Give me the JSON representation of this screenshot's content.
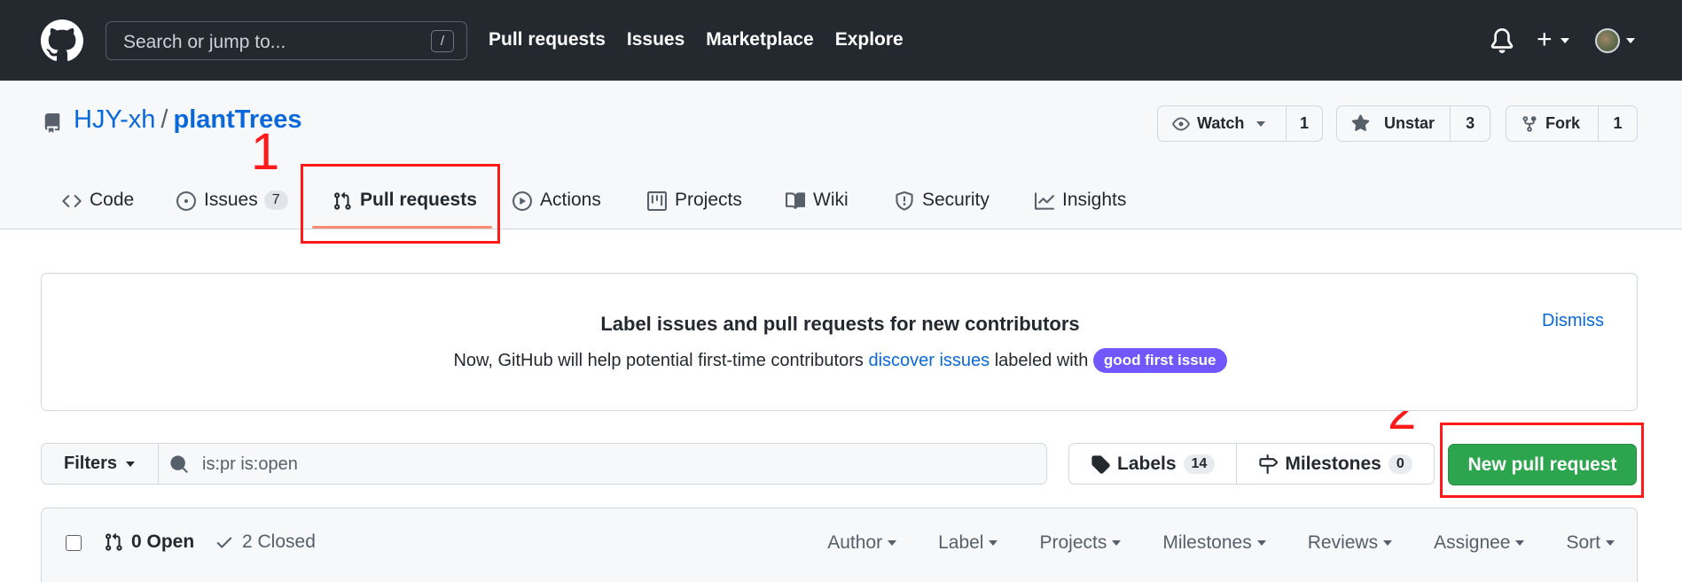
{
  "header": {
    "search_placeholder": "Search or jump to...",
    "search_shortcut": "/",
    "nav": [
      "Pull requests",
      "Issues",
      "Marketplace",
      "Explore"
    ]
  },
  "repo": {
    "owner": "HJY-xh",
    "separator": "/",
    "name": "plantTrees",
    "watch": {
      "label": "Watch",
      "count": "1"
    },
    "star": {
      "label": "Unstar",
      "count": "3"
    },
    "fork": {
      "label": "Fork",
      "count": "1"
    }
  },
  "tabs": [
    {
      "label": "Code",
      "icon": "code-icon"
    },
    {
      "label": "Issues",
      "count": "7",
      "icon": "issue-opened-icon"
    },
    {
      "label": "Pull requests",
      "icon": "git-pull-request-icon",
      "active": true
    },
    {
      "label": "Actions",
      "icon": "play-icon"
    },
    {
      "label": "Projects",
      "icon": "table-icon"
    },
    {
      "label": "Wiki",
      "icon": "book-icon"
    },
    {
      "label": "Security",
      "icon": "shield-icon"
    },
    {
      "label": "Insights",
      "icon": "graph-icon"
    }
  ],
  "annotations": {
    "first": "1",
    "second": "2"
  },
  "banner": {
    "title": "Label issues and pull requests for new contributors",
    "body_prefix": "Now, GitHub will help potential first-time contributors ",
    "link": "discover issues",
    "body_middle": " labeled with ",
    "label": "good first issue",
    "dismiss": "Dismiss"
  },
  "toolbar": {
    "filters": "Filters",
    "search_value": "is:pr is:open",
    "labels": {
      "label": "Labels",
      "count": "14"
    },
    "milestones": {
      "label": "Milestones",
      "count": "0"
    },
    "new_pr": "New pull request"
  },
  "list": {
    "open": "0 Open",
    "closed": "2 Closed",
    "sorts": [
      "Author",
      "Label",
      "Projects",
      "Milestones",
      "Reviews",
      "Assignee",
      "Sort"
    ]
  },
  "colors": {
    "header_bg": "#24292f",
    "link": "#0969da",
    "primary_button": "#2da44e",
    "label_purple": "#7057ff",
    "annotation": "#ff1a1a"
  }
}
